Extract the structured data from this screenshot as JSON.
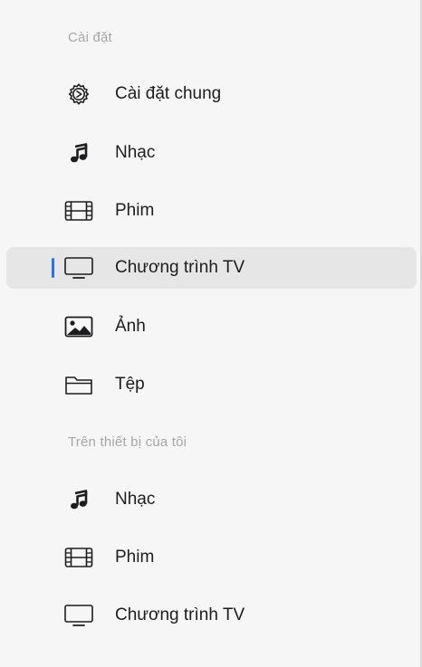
{
  "sidebar": {
    "settings_header": "Cài đặt",
    "settings_items": [
      {
        "label": "Cài đặt chung",
        "icon": "gear-icon"
      },
      {
        "label": "Nhạc",
        "icon": "music-note-icon"
      },
      {
        "label": "Phim",
        "icon": "film-icon"
      },
      {
        "label": "Chương trình TV",
        "icon": "tv-icon",
        "selected": true
      },
      {
        "label": "Ảnh",
        "icon": "photo-icon"
      },
      {
        "label": "Tệp",
        "icon": "folder-icon"
      }
    ],
    "device_header": "Trên thiết bị của tôi",
    "device_items": [
      {
        "label": "Nhạc",
        "icon": "music-note-icon"
      },
      {
        "label": "Phim",
        "icon": "film-icon"
      },
      {
        "label": "Chương trình TV",
        "icon": "tv-icon"
      }
    ]
  },
  "colors": {
    "sidebar_bg": "#f6f6f6",
    "selected_bg": "#e6e6e6",
    "accent": "#2c6ef2",
    "header_text": "#a6a6a6",
    "label_text": "#1d1d1f"
  }
}
